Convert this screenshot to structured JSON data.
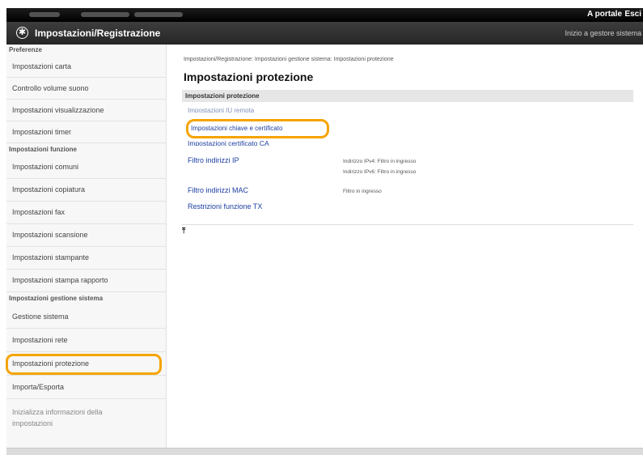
{
  "topbar": {
    "portal_link": "A portale",
    "logout_link": "Esci"
  },
  "titlebar": {
    "title": "Impostazioni/Registrazione",
    "maintenance_link": "Inizio a gestore sistema"
  },
  "sidebar": {
    "sections": [
      {
        "heading": "Preferenze",
        "items": [
          "Impostazioni carta",
          "Controllo volume suono",
          "Impostazioni visualizzazione",
          "Impostazioni timer"
        ]
      },
      {
        "heading": "Impostazioni funzione",
        "items": [
          "Impostazioni comuni",
          "Impostazioni copiatura",
          "Impostazioni fax",
          "Impostazioni scansione",
          "Impostazioni stampante",
          "Impostazioni stampa rapporto"
        ]
      },
      {
        "heading": "Impostazioni gestione sistema",
        "items": [
          "Gestione sistema",
          "Impostazioni rete",
          "Impostazioni protezione",
          "Importa/Esporta"
        ],
        "sub_item": [
          "Inizializza informazioni della",
          "impostazioni"
        ]
      }
    ],
    "active_item": "Impostazioni protezione"
  },
  "main": {
    "breadcrumb": "Impostazioni/Registrazione: Impostazioni gestione sistema: Impostazioni protezione",
    "title": "Impostazioni protezione",
    "section_header": "Impostazioni protezione",
    "links": [
      {
        "label": "Impostazioni IU remota"
      },
      {
        "label": "Impostazioni chiave e certificato"
      },
      {
        "label": "Impostazioni certificato CA"
      },
      {
        "label": "Filtro indirizzi IP",
        "details": [
          "Indirizzo IPv4: Filtro in ingresso",
          "Indirizzo IPv6: Filtro in ingresso"
        ]
      },
      {
        "label": "Filtro indirizzi MAC",
        "details": [
          "Filtro in ingresso"
        ]
      },
      {
        "label": "Restrizioni funzione TX"
      }
    ],
    "top_icon": "go-to-top-icon"
  },
  "colors": {
    "highlight": "#f5a400",
    "link": "#1c3fa0",
    "topbar": "#000000",
    "titlebar": "#333333"
  }
}
